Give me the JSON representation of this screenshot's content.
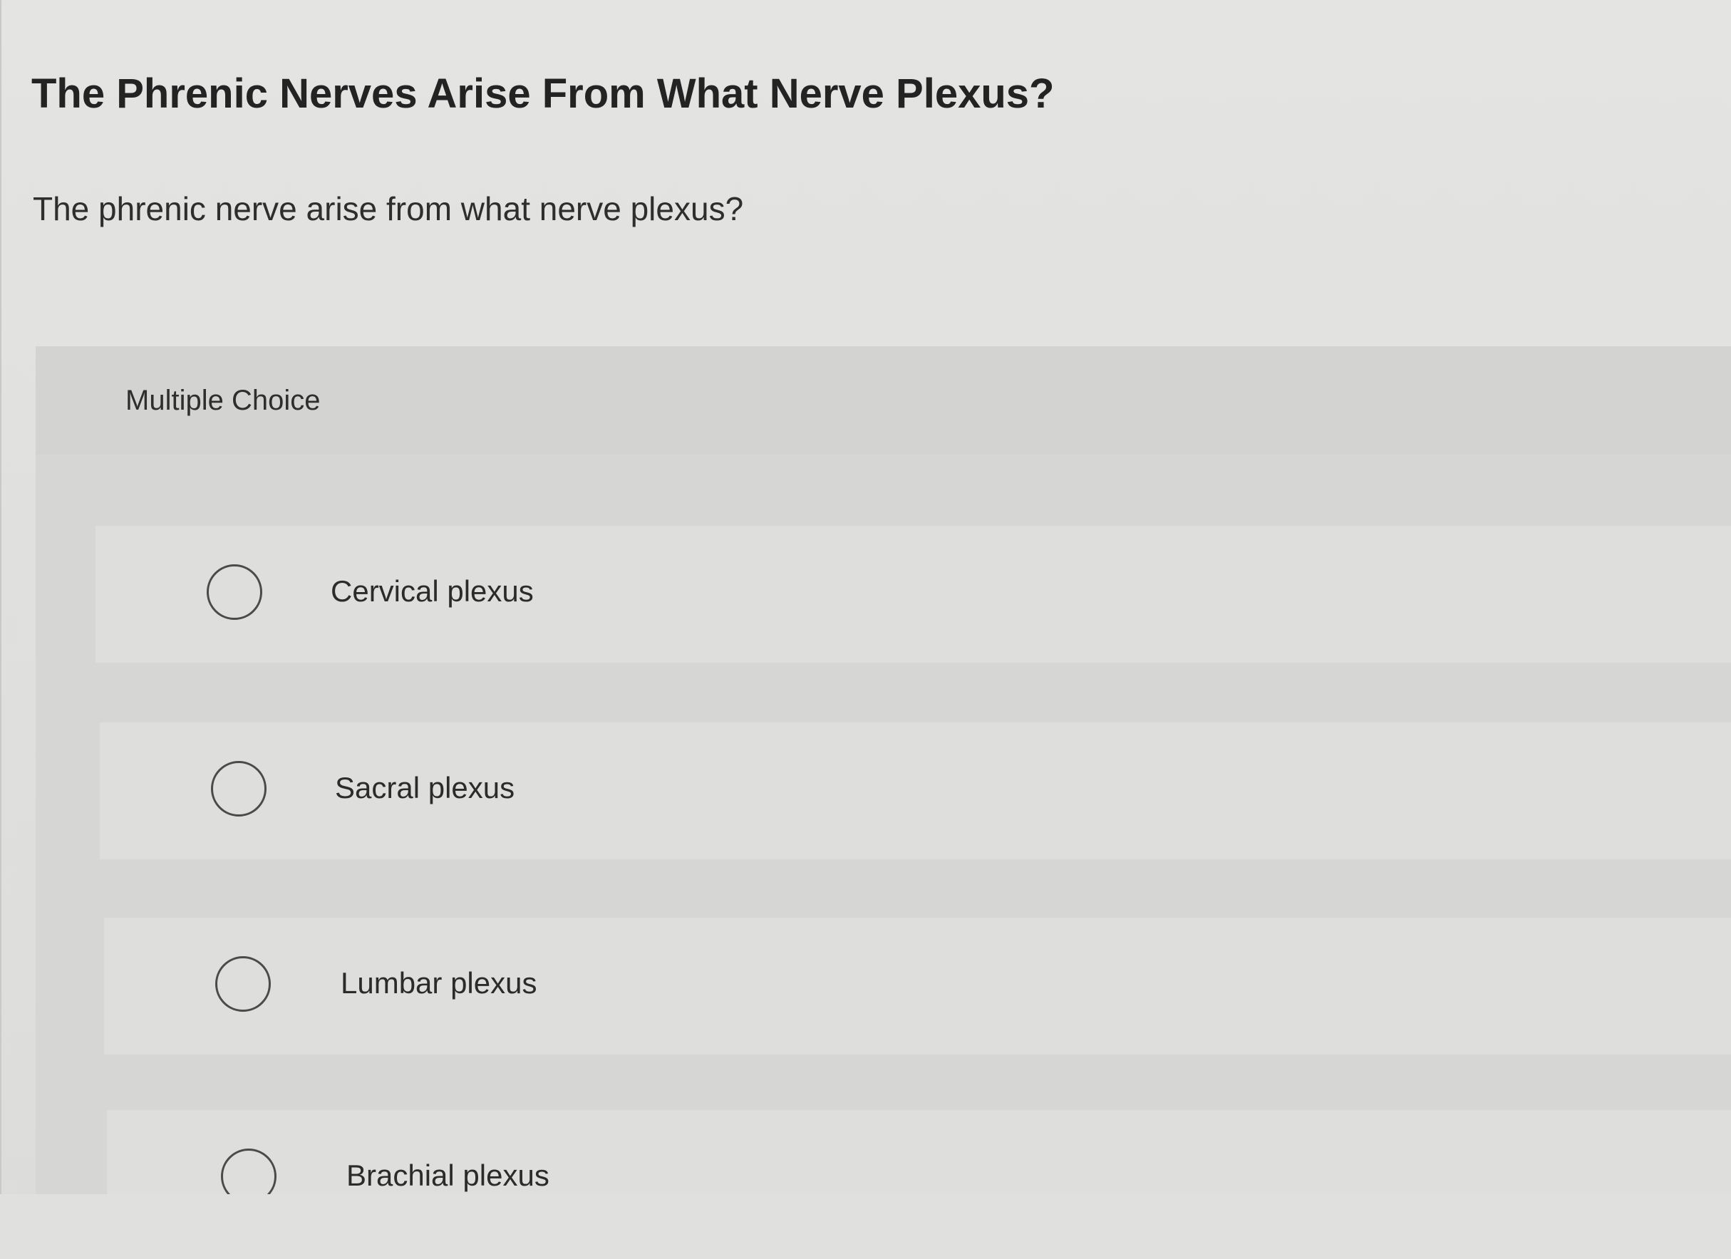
{
  "page": {
    "title": "The Phrenic Nerves Arise From What Nerve Plexus?",
    "question": "The phrenic nerve arise from what nerve plexus?"
  },
  "multiple_choice": {
    "label": "Multiple Choice",
    "options": [
      {
        "label": "Cervical plexus",
        "selected": false
      },
      {
        "label": "Sacral plexus",
        "selected": false
      },
      {
        "label": "Lumbar plexus",
        "selected": false
      },
      {
        "label": "Brachial plexus",
        "selected": false
      }
    ]
  },
  "colors": {
    "background": "#e2e2e0",
    "panel": "#d6d6d4",
    "option_row": "#dededc",
    "text": "#2b2b2b",
    "radio_border": "#4a4a4a"
  },
  "icons": {
    "radio": "radio-unchecked-icon"
  }
}
